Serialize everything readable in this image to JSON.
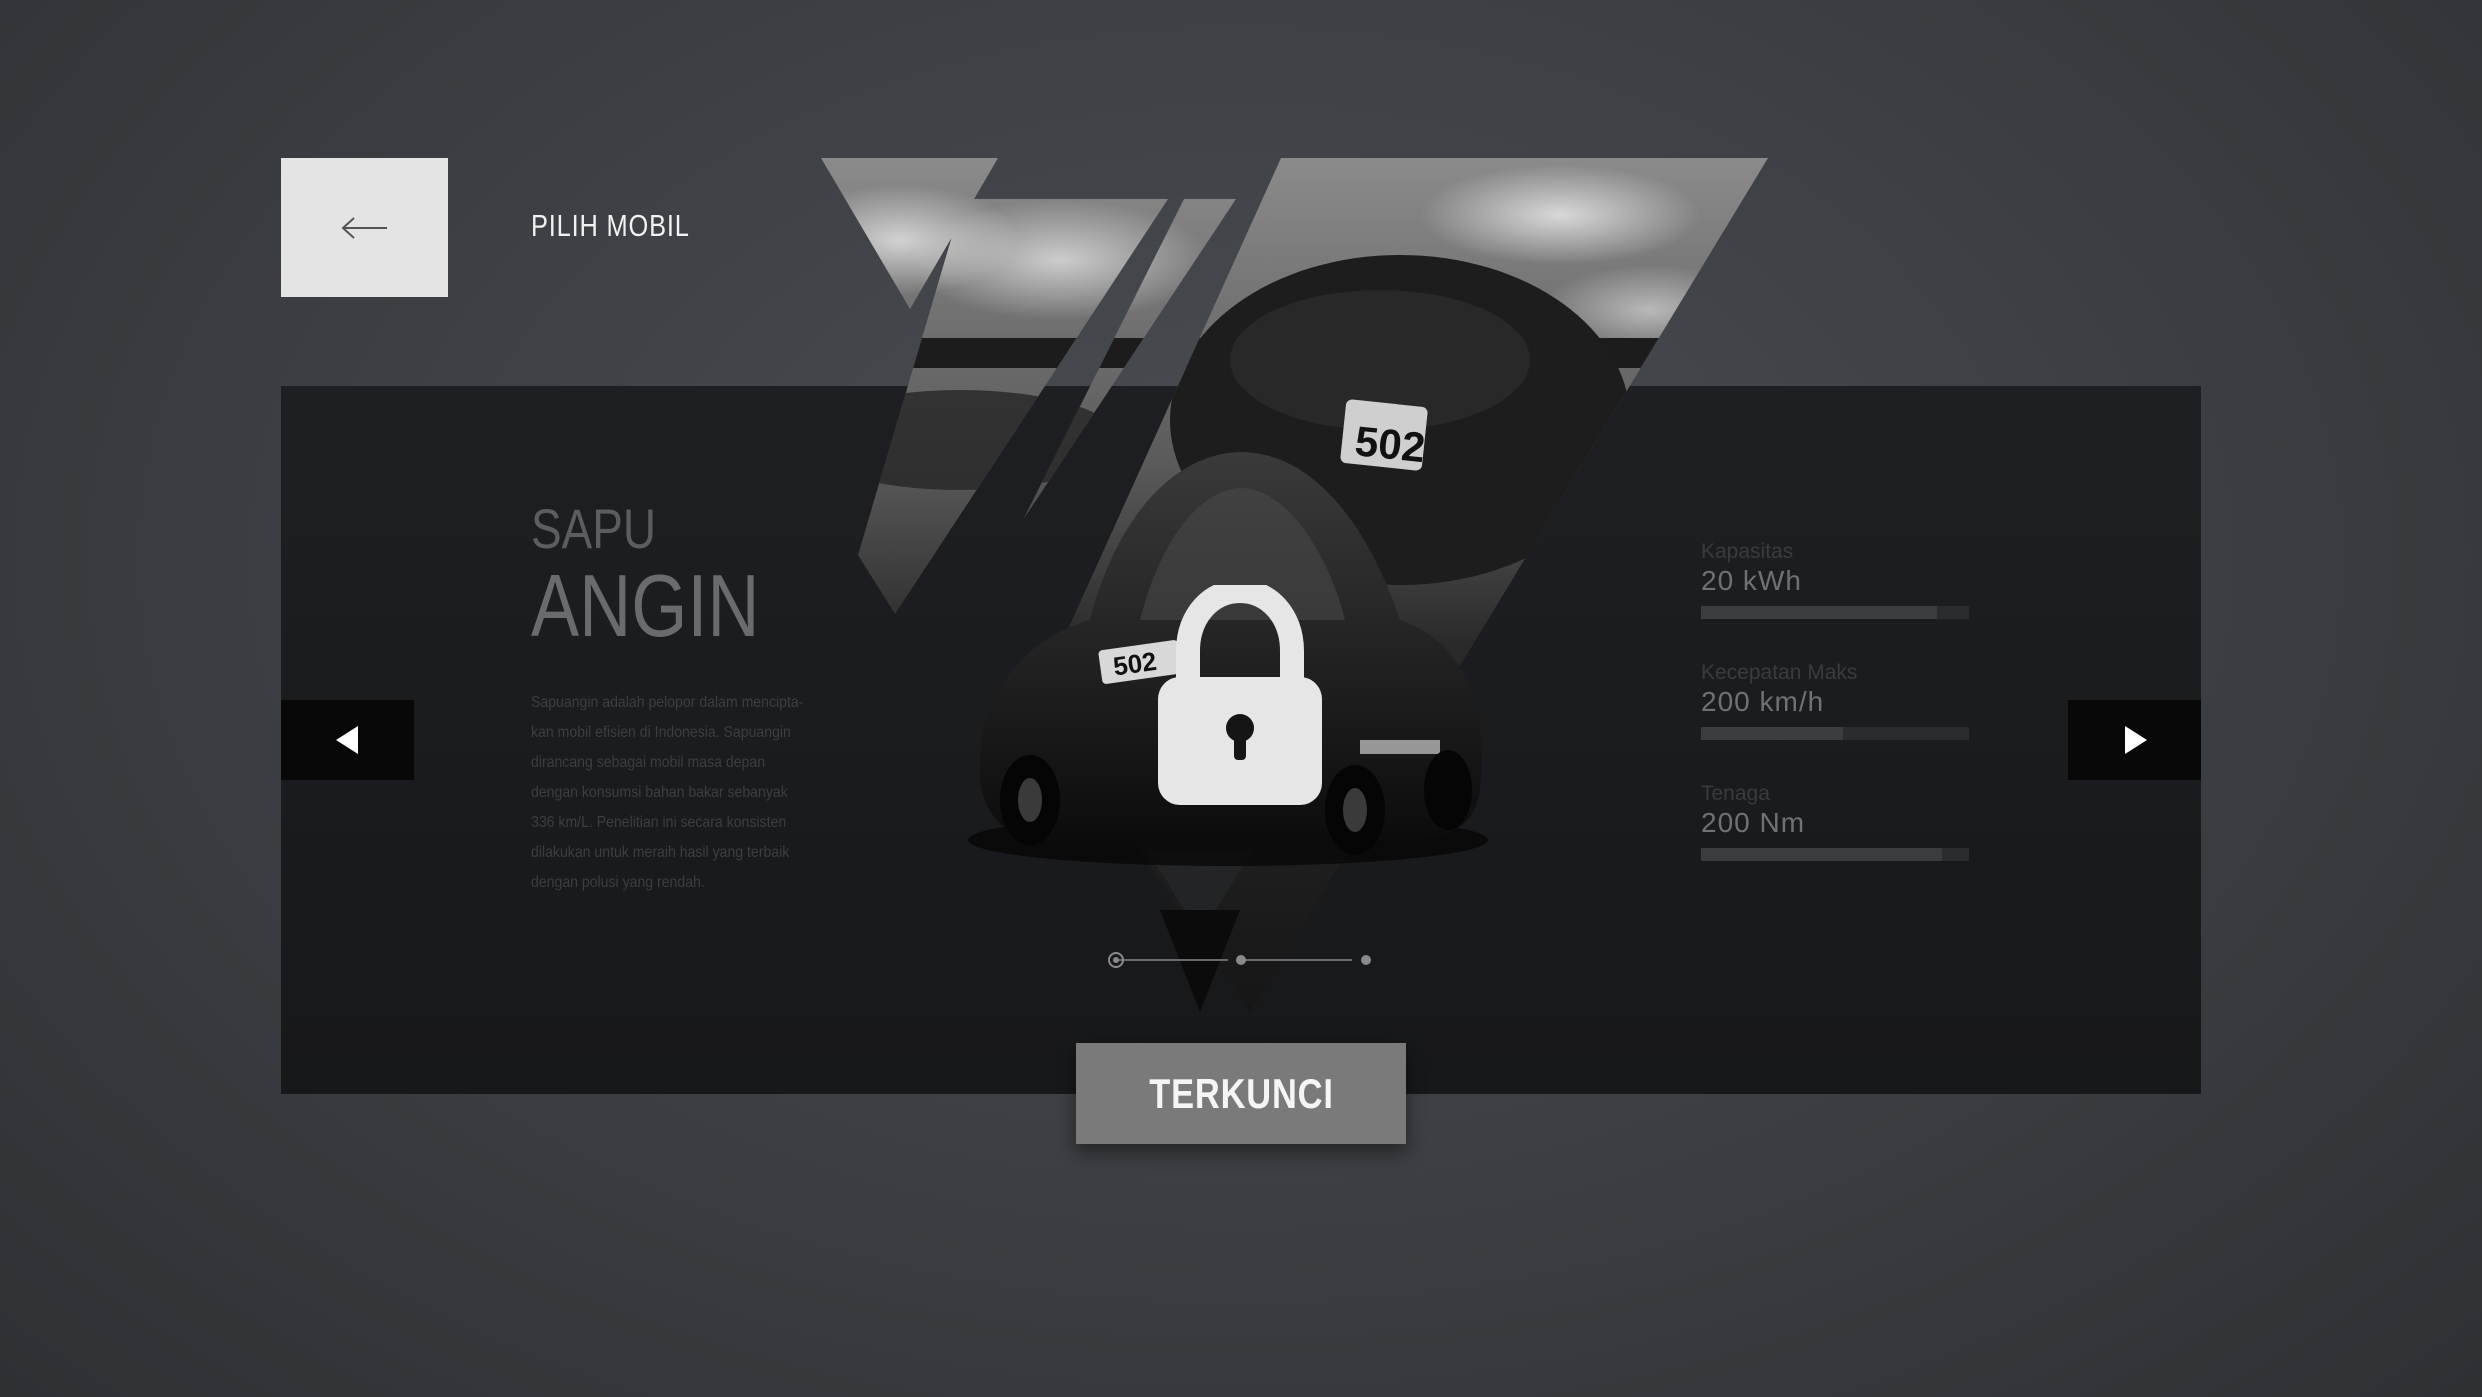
{
  "header": {
    "title": "PILIH MOBIL",
    "back_icon": "arrow-left-icon"
  },
  "car": {
    "name_top": "SAPU",
    "name_bottom": "ANGIN",
    "plate_number": "502",
    "description_lines": [
      "Sapuangin adalah pelopor dalam mencipta-",
      "kan mobil efisien di Indonesia. Sapuangin",
      "dirancang sebagai mobil masa depan",
      "dengan konsumsi bahan bakar sebanyak",
      "336 km/L. Penelitian ini secara konsisten",
      "dilakukan untuk meraih hasil yang terbaik",
      "dengan polusi yang rendah."
    ]
  },
  "stats": [
    {
      "label": "Kapasitas",
      "value": "20 kWh",
      "level": 0.88
    },
    {
      "label": "Kecepatan Maks",
      "value": "200 km/h",
      "level": 0.53
    },
    {
      "label": "Tenaga",
      "value": "200 Nm",
      "level": 0.9
    }
  ],
  "navigation": {
    "prev_icon": "triangle-left-icon",
    "next_icon": "triangle-right-icon",
    "page_count": 3,
    "current_page": 1
  },
  "status": {
    "locked_label": "TERKUNCI",
    "lock_icon": "padlock-icon"
  },
  "colors": {
    "background": "#3b3e42",
    "panel": "#1b1d20",
    "locked_button": "#7a7a7a",
    "back_button": "#e4e4e4"
  }
}
